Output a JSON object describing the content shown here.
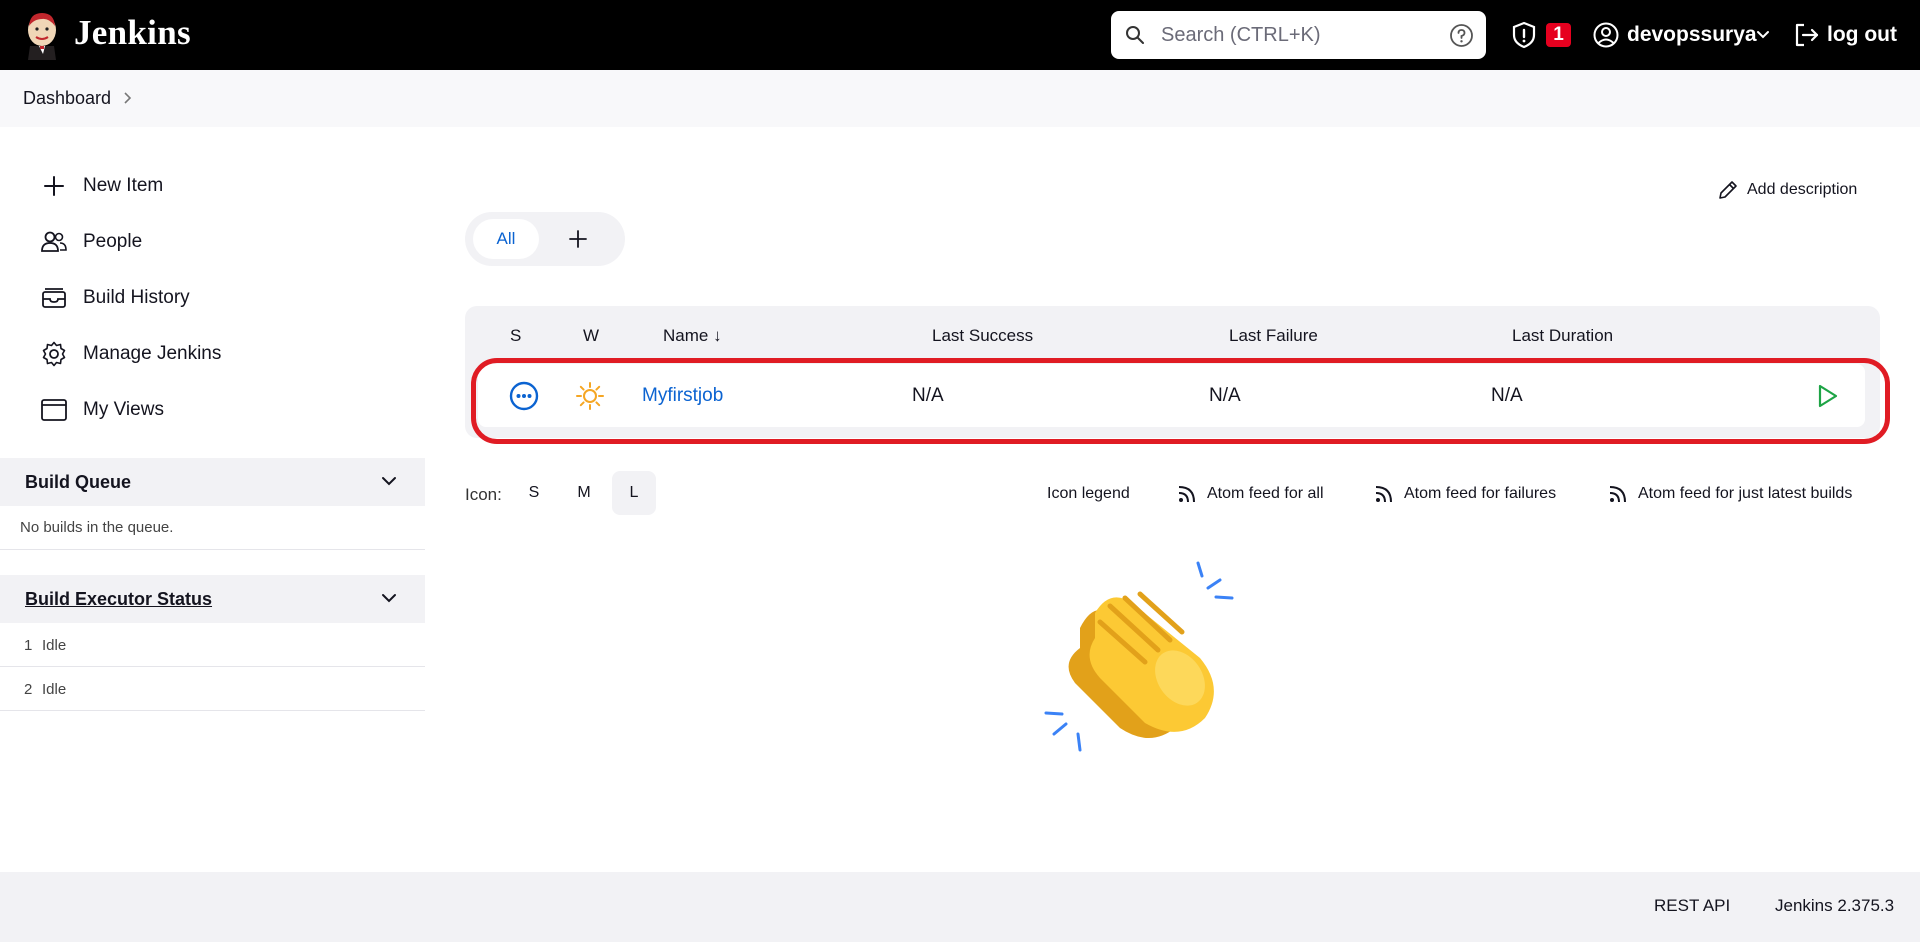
{
  "header": {
    "brand": "Jenkins",
    "search_placeholder": "Search (CTRL+K)",
    "security_badge_count": "1",
    "username": "devopssurya",
    "logout_label": "log out"
  },
  "breadcrumb": [
    "Dashboard"
  ],
  "sidebar": {
    "tasks": [
      {
        "label": "New Item",
        "icon": "plus-icon"
      },
      {
        "label": "People",
        "icon": "people-icon"
      },
      {
        "label": "Build History",
        "icon": "build-history-icon"
      },
      {
        "label": "Manage Jenkins",
        "icon": "gear-icon"
      },
      {
        "label": "My Views",
        "icon": "window-icon"
      }
    ],
    "build_queue": {
      "title": "Build Queue",
      "empty_text": "No builds in the queue."
    },
    "executors": {
      "title": "Build Executor Status",
      "rows": [
        {
          "num": "1",
          "status": "Idle"
        },
        {
          "num": "2",
          "status": "Idle"
        }
      ]
    }
  },
  "main": {
    "add_description": "Add description",
    "views": [
      {
        "label": "All",
        "active": true
      }
    ],
    "table": {
      "headers": [
        "S",
        "W",
        "Name",
        "Last Success",
        "Last Failure",
        "Last Duration"
      ],
      "sort_indicator": "↓",
      "rows": [
        {
          "status_icon": "not-built-icon",
          "weather_icon": "sunny-icon",
          "name": "Myfirstjob",
          "last_success": "N/A",
          "last_failure": "N/A",
          "last_duration": "N/A"
        }
      ]
    },
    "icon_size": {
      "label": "Icon:",
      "options": [
        "S",
        "M",
        "L"
      ],
      "selected": "L"
    },
    "links": {
      "icon_legend": "Icon legend",
      "atom_all": "Atom feed for all",
      "atom_failures": "Atom feed for failures",
      "atom_latest": "Atom feed for just latest builds"
    }
  },
  "footer": {
    "rest_api": "REST API",
    "version": "Jenkins 2.375.3"
  },
  "colors": {
    "header_bg": "#000000",
    "link_blue": "#0b63d1",
    "badge_red": "#e6001f",
    "highlight_red": "#e01c24",
    "run_green": "#1ea446"
  }
}
